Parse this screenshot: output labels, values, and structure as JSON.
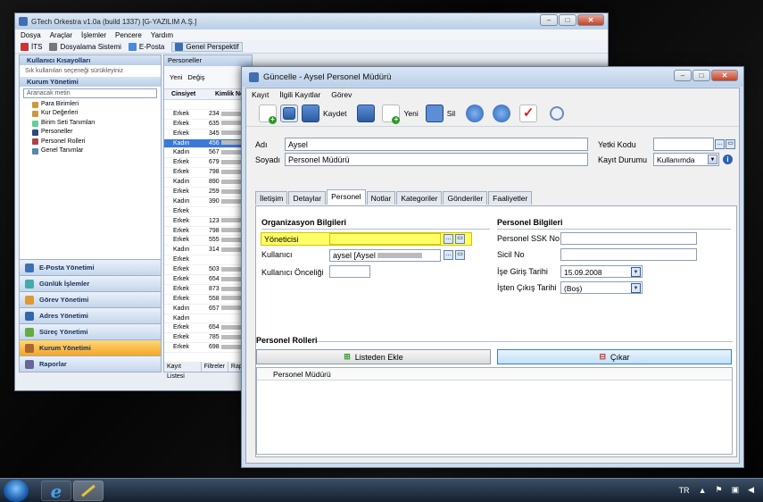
{
  "main_window": {
    "title": "GTech Orkestra v1.0a (build 1337) [G-YAZILIM A.Ş.]",
    "menu": [
      "Dosya",
      "Araçlar",
      "İşlemler",
      "Pencere",
      "Yardım"
    ],
    "toolbar": [
      "İTS",
      "Dosyalama Sistemi",
      "E-Posta",
      "Genel Perspektif"
    ],
    "shortcuts_title": "Kullanıcı Kısayolları",
    "shortcuts_hint": "Sık kullanılan seçeneği sürükleyiniz",
    "module_title": "Kurum Yönetimi",
    "search_placeholder": "Aranacak metin",
    "tree": [
      "Para Birimleri",
      "Kur Değerleri",
      "Birim Seti Tanımları",
      "Personeller",
      "Personel Rolleri",
      "Genel Tanımlar"
    ],
    "nav": [
      "E-Posta Yönetimi",
      "Günlük İşlemler",
      "Görev Yönetimi",
      "Adres Yönetimi",
      "Süreç Yönetimi",
      "Kurum Yönetimi",
      "Raporlar"
    ],
    "nav_active_index": 5
  },
  "grid": {
    "tab": "Personeller",
    "toolbar_new": "Yeni",
    "toolbar_edit": "Değiş",
    "col_gender": "Cinsiyet",
    "col_id": "Kimlik No",
    "rows": [
      {
        "g": "",
        "id": ""
      },
      {
        "g": "Erkek",
        "id": "234"
      },
      {
        "g": "Erkek",
        "id": "635"
      },
      {
        "g": "Erkek",
        "id": "345"
      },
      {
        "g": "Kadın",
        "id": "456"
      },
      {
        "g": "Kadın",
        "id": "567"
      },
      {
        "g": "Erkek",
        "id": "679"
      },
      {
        "g": "Erkek",
        "id": "798"
      },
      {
        "g": "Kadın",
        "id": "890"
      },
      {
        "g": "Erkek",
        "id": "259"
      },
      {
        "g": "Kadın",
        "id": "390"
      },
      {
        "g": "Erkek",
        "id": ""
      },
      {
        "g": "Erkek",
        "id": "123"
      },
      {
        "g": "Erkek",
        "id": "798"
      },
      {
        "g": "Erkek",
        "id": "555"
      },
      {
        "g": "Kadın",
        "id": "314"
      },
      {
        "g": "Erkek",
        "id": ""
      },
      {
        "g": "Erkek",
        "id": "503"
      },
      {
        "g": "Erkek",
        "id": "654"
      },
      {
        "g": "Erkek",
        "id": "873"
      },
      {
        "g": "Erkek",
        "id": "558"
      },
      {
        "g": "Kadın",
        "id": "657"
      },
      {
        "g": "Kadın",
        "id": ""
      },
      {
        "g": "Erkek",
        "id": "654"
      },
      {
        "g": "Erkek",
        "id": "785"
      },
      {
        "g": "Erkek",
        "id": "698"
      }
    ],
    "selected_row": 4,
    "bottom_tabs": [
      "Kayıt Listesi",
      "Filtreler",
      "Rapor"
    ]
  },
  "dialog": {
    "title": "Güncelle - Aysel Personel Müdürü",
    "menu": [
      "Kayıt",
      "İlgili Kayıtlar",
      "Görev"
    ],
    "toolbar": {
      "save": "Kaydet",
      "new": "Yeni",
      "delete": "Sil"
    },
    "fields": {
      "name_label": "Adı",
      "name_value": "Aysel",
      "surname_label": "Soyadı",
      "surname_value": "Personel Müdürü",
      "auth_label": "Yetki Kodu",
      "auth_value": "",
      "status_label": "Kayıt Durumu",
      "status_value": "Kullanımda"
    },
    "tabs": [
      "İletişim",
      "Detaylar",
      "Personel",
      "Notlar",
      "Kategoriler",
      "Gönderiler",
      "Faaliyetler"
    ],
    "active_tab": 2,
    "org": {
      "title": "Organizasyon Bilgileri",
      "manager_label": "Yöneticisi",
      "manager_value": "",
      "user_label": "Kullanıcı",
      "user_value": "aysel [Aysel",
      "user_priority_label": "Kullanıcı Önceliği",
      "user_priority_value": ""
    },
    "personnel": {
      "title": "Personel Bilgileri",
      "ssk_label": "Personel SSK No",
      "ssk_value": "",
      "sicil_label": "Sicil No",
      "sicil_value": "",
      "start_label": "İşe Giriş Tarihi",
      "start_value": "15.09.2008",
      "end_label": "İşten Çıkış Tarihi",
      "end_value": "(Boş)"
    },
    "roles": {
      "title": "Personel Rolleri",
      "add_button": "Listeden Ekle",
      "remove_button": "Çıkar",
      "column": "Personel Müdürü"
    }
  },
  "taskbar": {
    "lang": "TR"
  },
  "colors": {
    "highlight": "#ffff66",
    "selection": "#3b78d8",
    "nav_active": "#f5a623"
  }
}
